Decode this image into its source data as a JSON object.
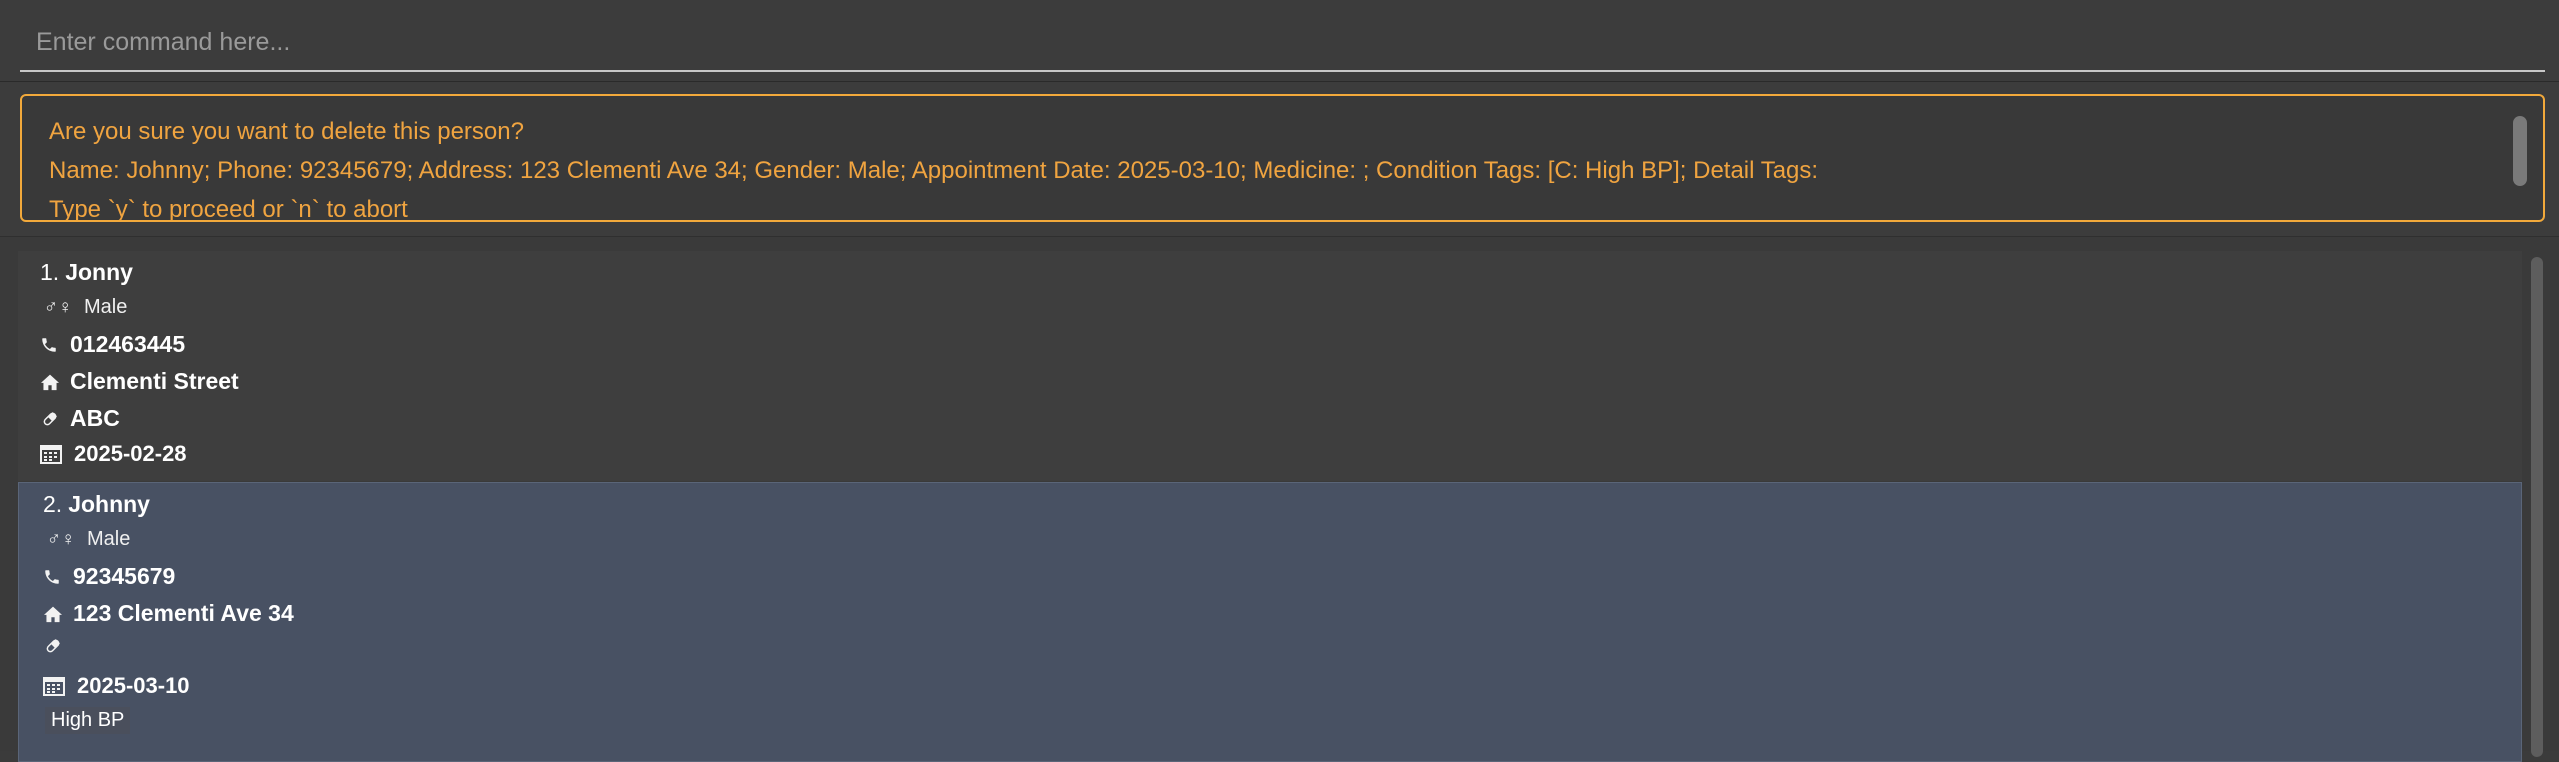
{
  "command": {
    "placeholder": "Enter command here..."
  },
  "result": {
    "line1": "Are you sure you want to delete this person?",
    "line2": "Name: Johnny; Phone: 92345679; Address: 123 Clementi Ave 34; Gender: Male; Appointment Date: 2025-03-10; Medicine: ; Condition Tags: [C: High BP]; Detail Tags:",
    "line3": "Type `y` to proceed or `n` to abort"
  },
  "persons": [
    {
      "index": "1.",
      "name": "Jonny",
      "gender": "Male",
      "phone": "012463445",
      "address": "Clementi Street",
      "medicine": "ABC",
      "date": "2025-02-28",
      "tags": []
    },
    {
      "index": "2.",
      "name": "Johnny",
      "gender": "Male",
      "phone": "92345679",
      "address": "123 Clementi Ave 34",
      "medicine": "",
      "date": "2025-03-10",
      "tags": [
        "High BP"
      ]
    }
  ],
  "icons": {
    "gender": "gender-icon",
    "phone": "phone-icon",
    "address": "home-icon",
    "medicine": "pill-icon",
    "date": "calendar-icon"
  },
  "colors": {
    "accent": "#f2a93b",
    "selected_card": "#485163"
  }
}
